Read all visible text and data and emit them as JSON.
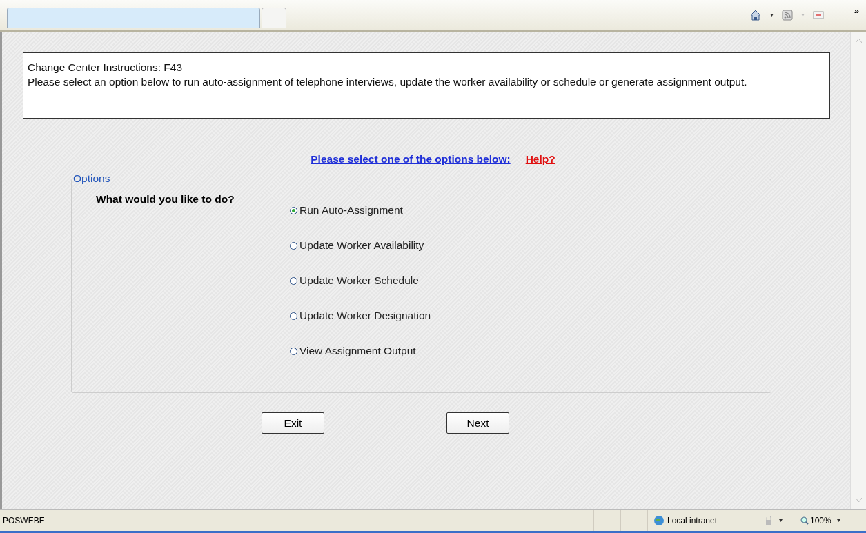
{
  "toolbar": {
    "overflow": "»"
  },
  "instructions": {
    "title": "Change Center Instructions: F43",
    "text": "Please select an option below to run auto-assignment of telephone interviews, update the worker availability or schedule or generate assignment output."
  },
  "prompt": {
    "link": "Please select one of the options below:",
    "help": "Help?"
  },
  "options": {
    "legend": "Options",
    "question": "What would you like to do?",
    "items": [
      {
        "label": "Run Auto-Assignment",
        "selected": true
      },
      {
        "label": "Update Worker Availability",
        "selected": false
      },
      {
        "label": "Update Worker Schedule",
        "selected": false
      },
      {
        "label": "Update Worker Designation",
        "selected": false
      },
      {
        "label": "View Assignment Output",
        "selected": false
      }
    ]
  },
  "buttons": [
    "Exit",
    "Next"
  ],
  "status_bar": {
    "text": "POSWEBE",
    "zone": "Local intranet",
    "zoom": "100%"
  }
}
